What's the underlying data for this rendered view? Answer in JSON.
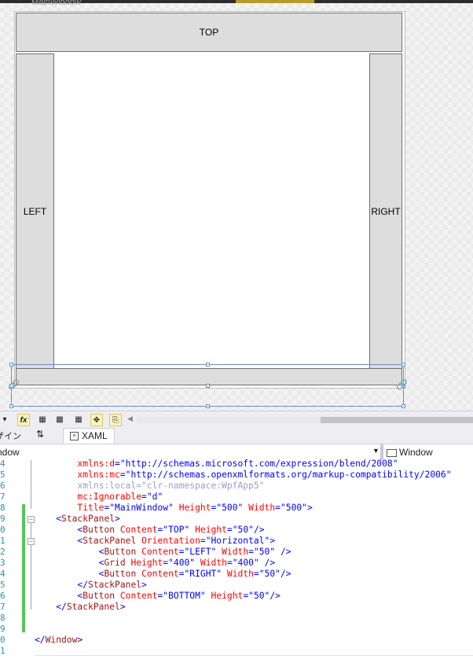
{
  "designer": {
    "window_title": "MainWindow",
    "buttons": {
      "top": "TOP",
      "left": "LEFT",
      "right": "RIGHT"
    }
  },
  "toolbar": {
    "fx_label": "fx"
  },
  "tabs": {
    "design_label": "ザイン",
    "swap_label": "⇅",
    "xaml_label": "XAML"
  },
  "navbar": {
    "left_scope": "ndow",
    "right_scope": "Window"
  },
  "editor": {
    "lines": [
      {
        "n": "4",
        "text": "xmlns:d=\"http://schemas.microsoft.com/expression/blend/2008\""
      },
      {
        "n": "5",
        "text": "xmlns:mc=\"http://schemas.openxmlformats.org/markup-compatibility/2006\""
      },
      {
        "n": "6",
        "text": "xmlns:local=\"clr-namespace:WpfApp5\""
      },
      {
        "n": "7",
        "text": "mc:Ignorable=\"d\""
      },
      {
        "n": "8",
        "text": "Title=\"MainWindow\" Height=\"500\" Width=\"500\">"
      },
      {
        "n": "9",
        "text": "<StackPanel>"
      },
      {
        "n": "0",
        "text": "<Button Content=\"TOP\" Height=\"50\"/>"
      },
      {
        "n": "1",
        "text": "<StackPanel Orientation=\"Horizontal\">"
      },
      {
        "n": "2",
        "text": "<Button Content=\"LEFT\" Width=\"50\" />"
      },
      {
        "n": "3",
        "text": "<Grid Height=\"400\" Width=\"400\" />"
      },
      {
        "n": "4",
        "text": "<Button Content=\"RIGHT\" Width=\"50\"/>"
      },
      {
        "n": "5",
        "text": "</StackPanel>"
      },
      {
        "n": "6",
        "text": "<Button Content=\"BOTTOM\" Height=\"50\"/>"
      },
      {
        "n": "7",
        "text": "</StackPanel>"
      },
      {
        "n": "8",
        "text": ""
      },
      {
        "n": "9",
        "text": ""
      },
      {
        "n": "0",
        "text": "</Window>"
      },
      {
        "n": "1",
        "text": ""
      }
    ]
  }
}
